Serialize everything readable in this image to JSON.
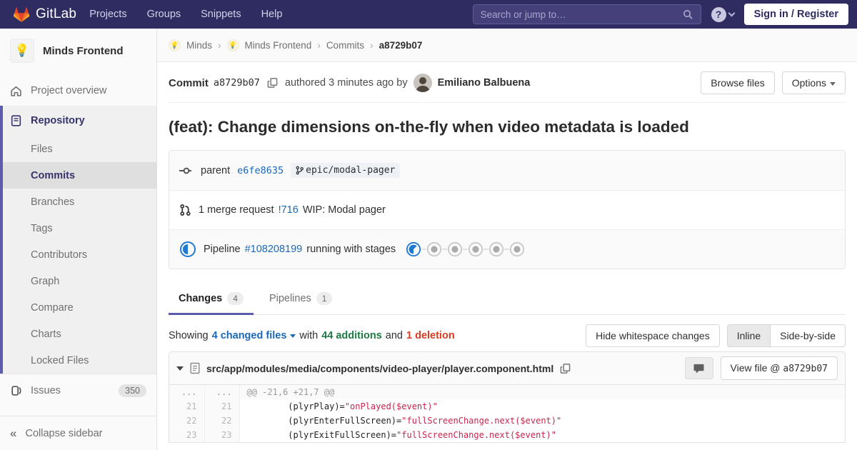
{
  "navbar": {
    "brand": "GitLab",
    "items": [
      "Projects",
      "Groups",
      "Snippets",
      "Help"
    ],
    "search_placeholder": "Search or jump to…",
    "sign_in": "Sign in / Register"
  },
  "sidebar": {
    "project_name": "Minds Frontend",
    "project_avatar_emoji": "💡",
    "overview": "Project overview",
    "repository": "Repository",
    "repo_items": [
      "Files",
      "Commits",
      "Branches",
      "Tags",
      "Contributors",
      "Graph",
      "Compare",
      "Charts",
      "Locked Files"
    ],
    "active_repo_item": "Commits",
    "issues": "Issues",
    "issues_count": "350",
    "collapse": "Collapse sidebar"
  },
  "breadcrumb": {
    "items": [
      "Minds",
      "Minds Frontend",
      "Commits"
    ],
    "current": "a8729b07",
    "avatar_emoji": "💡"
  },
  "commit": {
    "label": "Commit",
    "sha": "a8729b07",
    "authored": "authored 3 minutes ago by",
    "author": "Emiliano Balbuena",
    "browse_files": "Browse files",
    "options": "Options",
    "title": "(feat): Change dimensions on-the-fly when video metadata is loaded",
    "parent_label": "parent",
    "parent_sha": "e6fe8635",
    "branch": "epic/modal-pager",
    "mr_text": "1 merge request",
    "mr_id": "!716",
    "mr_title": "WIP: Modal pager",
    "pipeline_label": "Pipeline",
    "pipeline_id": "#108208199",
    "pipeline_status_text": "running with stages",
    "stages": [
      "running",
      "created",
      "created",
      "created",
      "created",
      "created"
    ]
  },
  "tabs": {
    "changes": "Changes",
    "changes_count": "4",
    "pipelines": "Pipelines",
    "pipelines_count": "1"
  },
  "summary": {
    "showing": "Showing",
    "files": "4 changed files",
    "with": "with",
    "additions": "44 additions",
    "and": "and",
    "deletions": "1 deletion",
    "hide_whitespace": "Hide whitespace changes",
    "inline": "Inline",
    "side_by_side": "Side-by-side"
  },
  "diff": {
    "path": "src/app/modules/media/components/video-player/player.component.html",
    "view_file_label": "View file @",
    "view_file_sha": "a8729b07",
    "ellipsis": "...",
    "hunk": "@@ -21,6 +21,7 @@",
    "lines": [
      {
        "old": "21",
        "new": "21",
        "code_pre": "        (plyrPlay)=",
        "code_str": "\"onPlayed($event)\""
      },
      {
        "old": "22",
        "new": "22",
        "code_pre": "        (plyrEnterFullScreen)=",
        "code_str": "\"fullScreenChange.next($event)\""
      },
      {
        "old": "23",
        "new": "23",
        "code_pre": "        (plyrExitFullScreen)=",
        "code_str": "\"fullScreenChange.next($event)\""
      }
    ]
  },
  "colors": {
    "navbar_bg": "#2f2c61",
    "accent_indigo": "#5e5bab",
    "link_blue": "#1b69b6",
    "additions_green": "#1e7b45",
    "deletions_red": "#db3b21",
    "running_blue": "#1f78d1",
    "string_red": "#c7254e"
  }
}
